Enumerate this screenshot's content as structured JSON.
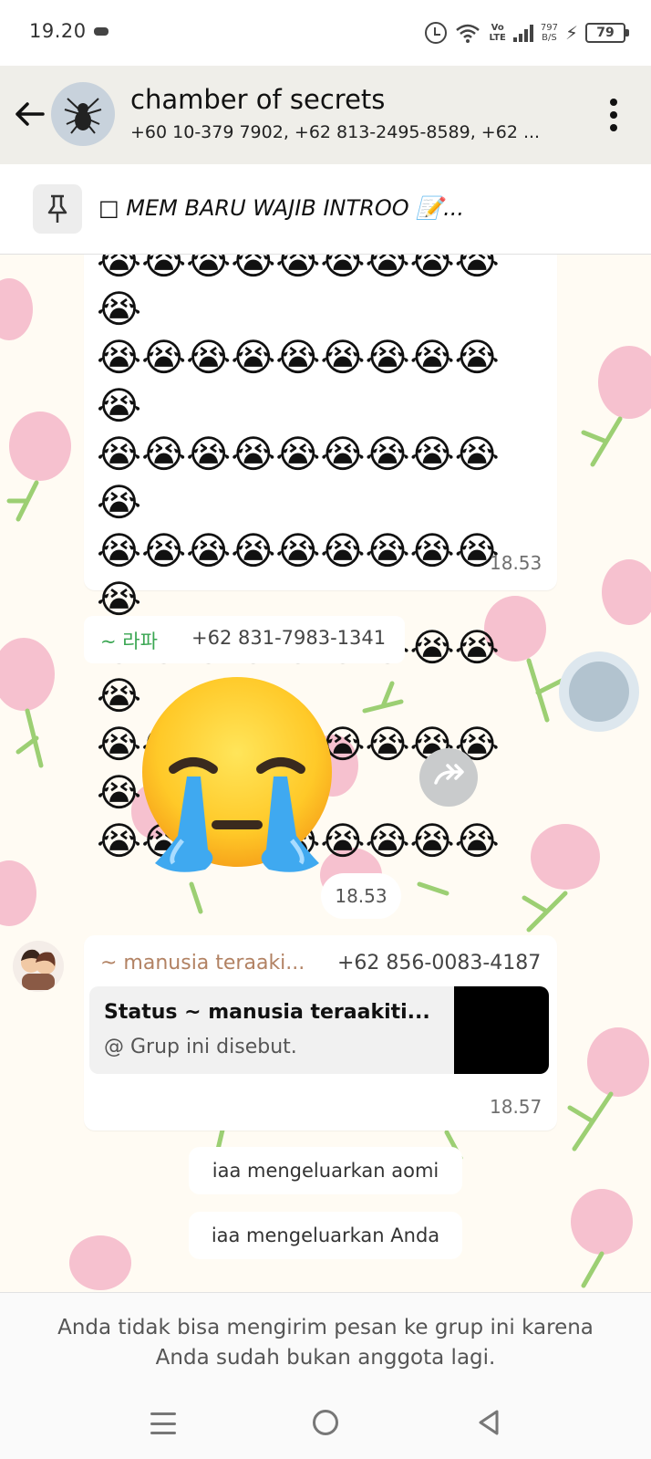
{
  "status_bar": {
    "time": "19.20",
    "network_type": "Vo LTE",
    "speed": "797 B/S",
    "battery": "79",
    "icons": [
      "gamepad-icon",
      "alarm-icon",
      "wifi-icon",
      "volte-icon",
      "signal-icon",
      "speed-icon",
      "charging-icon",
      "battery-icon"
    ]
  },
  "header": {
    "title": "chamber of secrets",
    "members": "+60 10-379 7902, +62 813-2495-8589, +62 ...",
    "avatar_icon": "spider-icon",
    "back_icon": "arrow-left-icon",
    "menu_icon": "more-vertical-icon"
  },
  "pinned": {
    "icon": "pin-icon",
    "text": "□ MEM BARU WAJIB INTROO 📝..."
  },
  "messages": {
    "emoji_block": {
      "emoji": "😭",
      "rows": 7,
      "full_row_count": 10,
      "last_row_count": 9,
      "time": "18.53"
    },
    "sender_1": {
      "name": "~ 라파",
      "phone": "+62 831-7983-1341"
    },
    "sticker": {
      "emoji": "crying-face",
      "time": "18.53"
    },
    "quoted": {
      "sender_name": "~ manusia teraaki...",
      "phone": "+62 856-0083-4187",
      "quote_title": "Status ~ manusia teraakiti...",
      "quote_sub": "@ Grup ini disebut.",
      "time": "18.57"
    },
    "system": [
      "iaa mengeluarkan aomi",
      "iaa mengeluarkan Anda"
    ]
  },
  "footer": {
    "notice_line_1": "Anda tidak bisa mengirim pesan ke grup ini karena",
    "notice_line_2": "Anda sudah bukan anggota lagi."
  },
  "colors": {
    "header_bg": "#efeee9",
    "sender_1_name": "#3aa652",
    "sender_2_name": "#b28263",
    "wallpaper": "#fffbf3",
    "tulip": "#f6c1cf",
    "stem": "#9ccf73"
  }
}
